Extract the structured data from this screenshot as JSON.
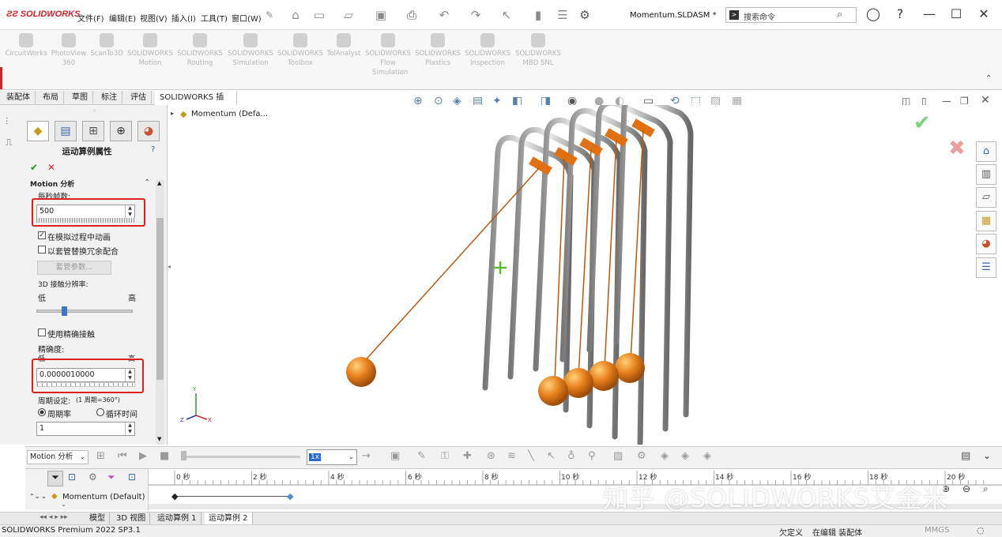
{
  "app": {
    "logo_text": "SOLIDWORKS",
    "document_title": "Momentum.SLDASM *"
  },
  "menu": [
    "文件(F)",
    "编辑(E)",
    "视图(V)",
    "插入(I)",
    "工具(T)",
    "窗口(W)"
  ],
  "search": {
    "placeholder": "搜索命令"
  },
  "addins": [
    {
      "label": "CircuitWorks",
      "sub": ""
    },
    {
      "label": "PhotoView",
      "sub": "360"
    },
    {
      "label": "ScanTo3D",
      "sub": ""
    },
    {
      "label": "SOLIDWORKS",
      "sub": "Motion"
    },
    {
      "label": "SOLIDWORKS",
      "sub": "Routing"
    },
    {
      "label": "SOLIDWORKS",
      "sub": "Simulation"
    },
    {
      "label": "SOLIDWORKS",
      "sub": "Toolbox"
    },
    {
      "label": "TolAnalyst",
      "sub": ""
    },
    {
      "label": "SOLIDWORKS",
      "sub": "Flow Simulation"
    },
    {
      "label": "SOLIDWORKS",
      "sub": "Plastics"
    },
    {
      "label": "SOLIDWORKS",
      "sub": "Inspection"
    },
    {
      "label": "SOLIDWORKS",
      "sub": "MBD SNL"
    }
  ],
  "tabs": [
    "装配体",
    "布局",
    "草图",
    "标注",
    "评估",
    "SOLIDWORKS 插件"
  ],
  "tree": {
    "root": "Momentum  (Defa..."
  },
  "panel": {
    "title": "运动算例属性",
    "section": "Motion 分析",
    "fps_label": "每秒帧数:",
    "fps_value": "500",
    "animate_label": "在模拟过程中动画",
    "replace_label": "以套管替换冗余配合",
    "bushing_button": "套管参数...",
    "contact_label": "3D 接触分辨率:",
    "low": "低",
    "high": "高",
    "precise_label": "使用精确接触",
    "accuracy_label": "精确度:",
    "accuracy_value": "0.0000010000",
    "cycle_label": "周期设定:",
    "cycle_note": "(1 周期=360°)",
    "cycle_rate": "周期率",
    "cycle_time": "循环时间",
    "cycle_value": "1"
  },
  "motion": {
    "type": "Motion 分析",
    "speed": "1x",
    "tree_item": "Momentum (Default) -",
    "ticks": [
      "0 秒",
      "2 秒",
      "4 秒",
      "6 秒",
      "8 秒",
      "10 秒",
      "12 秒",
      "14 秒",
      "16 秒",
      "18 秒",
      "20 秒"
    ]
  },
  "bottom_tabs": [
    "模型",
    "3D 视图",
    "运动算例 1",
    "运动算例 2"
  ],
  "status": {
    "left": "SOLIDWORKS Premium 2022 SP3.1",
    "underdef": "欠定义",
    "editing": "在编辑 装配体",
    "units": "MMGS"
  },
  "watermark": "知乎 @SOLIDWORKS艾金米",
  "colors": {
    "accent_red": "#d2232a",
    "highlight_box": "#e02020",
    "ball_orange": "#e8821e",
    "rod_gray": "#a8a8a8"
  }
}
